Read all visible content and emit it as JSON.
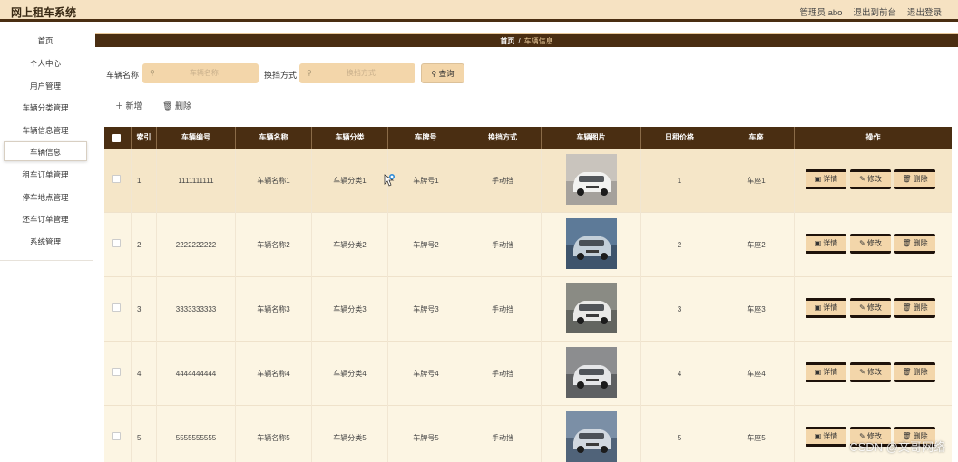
{
  "app": {
    "title": "网上租车系统"
  },
  "top_links": [
    "管理员 abo",
    "退出到前台",
    "退出登录"
  ],
  "sidebar": {
    "items": [
      {
        "label": "首页"
      },
      {
        "label": "个人中心"
      },
      {
        "label": "用户管理"
      },
      {
        "label": "车辆分类管理"
      },
      {
        "label": "车辆信息管理"
      },
      {
        "label": "车辆信息",
        "active": true
      },
      {
        "label": "租车订单管理"
      },
      {
        "label": "停车地点管理"
      },
      {
        "label": "还车订单管理"
      },
      {
        "label": "系统管理"
      }
    ]
  },
  "breadcrumb": {
    "home": "首页",
    "separator": "/",
    "current": "车辆信息"
  },
  "search": {
    "name_label": "车辆名称",
    "name_placeholder": "车辆名称",
    "gear_label": "换挡方式",
    "gear_placeholder": "换挡方式",
    "button_label": "查询"
  },
  "actions": {
    "add_label": "新增",
    "delete_label": "删除"
  },
  "table": {
    "headers": [
      "索引",
      "车辆编号",
      "车辆名称",
      "车辆分类",
      "车牌号",
      "换挡方式",
      "车辆图片",
      "日租价格",
      "车座",
      "操作"
    ],
    "rows": [
      {
        "index": "1",
        "code": "1111111111",
        "name": "车辆名称1",
        "category": "车辆分类1",
        "plate": "车牌号1",
        "gear": "手动挡",
        "price": "1",
        "seat": "车座1"
      },
      {
        "index": "2",
        "code": "2222222222",
        "name": "车辆名称2",
        "category": "车辆分类2",
        "plate": "车牌号2",
        "gear": "手动挡",
        "price": "2",
        "seat": "车座2"
      },
      {
        "index": "3",
        "code": "3333333333",
        "name": "车辆名称3",
        "category": "车辆分类3",
        "plate": "车牌号3",
        "gear": "手动挡",
        "price": "3",
        "seat": "车座3"
      },
      {
        "index": "4",
        "code": "4444444444",
        "name": "车辆名称4",
        "category": "车辆分类4",
        "plate": "车牌号4",
        "gear": "手动挡",
        "price": "4",
        "seat": "车座4"
      },
      {
        "index": "5",
        "code": "5555555555",
        "name": "车辆名称5",
        "category": "车辆分类5",
        "plate": "车牌号5",
        "gear": "手动挡",
        "price": "5",
        "seat": "车座5"
      }
    ],
    "row_actions": {
      "detail": "详情",
      "edit": "修改",
      "delete": "删除"
    }
  },
  "watermark": "CSDN @文哥网络",
  "colors": {
    "accent_dark": "#4a2e12",
    "accent_light": "#f3d6aa",
    "topbar_bg": "#f6e2c2",
    "row_bg": "#fcf5e3"
  },
  "icons": [
    "search-icon",
    "plus-icon",
    "trash-icon",
    "detail-icon",
    "edit-icon",
    "cursor-icon"
  ]
}
